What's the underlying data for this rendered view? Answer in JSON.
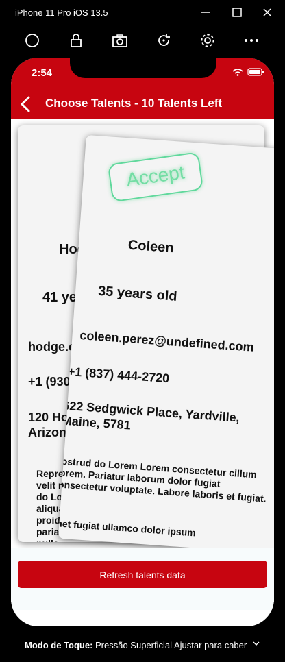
{
  "window": {
    "title": "iPhone 11 Pro iOS 13.5",
    "toolbar_icons": [
      "home-circle-icon",
      "lock-icon",
      "camera-icon",
      "rotate-icon",
      "settings-gear-icon",
      "more-icon"
    ]
  },
  "status_bar": {
    "time": "2:54"
  },
  "nav": {
    "title": "Choose Talents - 10 Talents Left",
    "back_icon": "chevron-left-icon"
  },
  "colors": {
    "brand_red": "#c70510",
    "accept_green": "#49d68a"
  },
  "cards": {
    "back": {
      "name": "Hodge",
      "age": "41 years old",
      "email": "hodge.cochran@undefined.com",
      "phone": "+1 (930) 594-3232",
      "address_line1": "120 Howard Place,",
      "address_line2": "Arizona, 3",
      "about": "Reprehenderit velit magna do Lorem aliqua labore proident pariatur nulla."
    },
    "front": {
      "stamp": "Accept",
      "name": "Coleen",
      "age": "35 years old",
      "email": "coleen.perez@undefined.com",
      "phone": "+1 (837) 444-2720",
      "address": "622 Sedgwick Place, Yardville, Maine, 5781",
      "about1": "Nostrud do Lorem Lorem consectetur cillum Lorem. Pariatur laborum dolor fugiat consectetur voluptate. Labore laboris et fugiat.",
      "about2": "Amet fugiat ullamco dolor ipsum"
    }
  },
  "footer": {
    "refresh_label": "Refresh talents data"
  },
  "touch_mode": {
    "label": "Modo de Toque:",
    "option1": "Pressão Superficial",
    "option2": "Ajustar para caber"
  }
}
